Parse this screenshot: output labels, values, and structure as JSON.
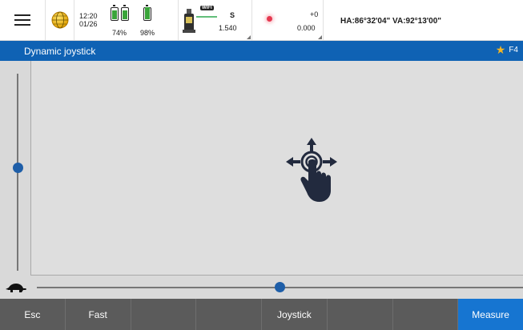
{
  "status": {
    "time": "12:20",
    "date": "01/26",
    "battery1_percent": "74%",
    "battery2_percent": "98%",
    "battery1_level": 0.74,
    "battery2_level": 0.98,
    "wifi_label": "WIFI",
    "instrument_face": "S",
    "instrument_value": "1.540",
    "target_offset": "+0",
    "target_height": "0.000",
    "angles": "HA:86°32'04\"  VA:92°13'00\""
  },
  "titlebar": {
    "title": "Dynamic joystick",
    "favorite_key": "F4"
  },
  "joystick": {
    "vertical_speed_level": 0.5,
    "horizontal_speed_level": 0.5
  },
  "softkeys": [
    {
      "label": "Esc"
    },
    {
      "label": "Fast"
    },
    {
      "label": ""
    },
    {
      "label": ""
    },
    {
      "label": "Joystick"
    },
    {
      "label": ""
    },
    {
      "label": ""
    },
    {
      "label": "Measure"
    }
  ],
  "colors": {
    "accent": "#0f62b4",
    "primary_key": "#1675d1",
    "slider_thumb": "#1e5ea8",
    "battery_fill": "#3aa43a",
    "target_dot": "#e53950"
  }
}
